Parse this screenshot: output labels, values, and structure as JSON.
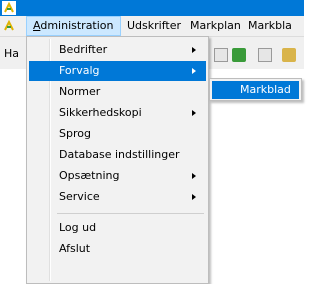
{
  "menubar": {
    "items": [
      {
        "accel": "A",
        "rest": "dministration"
      },
      {
        "label": "Udskrifter"
      },
      {
        "label": "Markplan"
      },
      {
        "label": "Markbla"
      }
    ]
  },
  "toolbar": {
    "label": "Ha"
  },
  "administration_menu": {
    "items": [
      {
        "label": "Bedrifter",
        "submenu": true
      },
      {
        "label": "Forvalg",
        "submenu": true,
        "selected": true
      },
      {
        "label": "Normer",
        "submenu": false
      },
      {
        "label": "Sikkerhedskopi",
        "submenu": true
      },
      {
        "label": "Sprog",
        "submenu": false
      },
      {
        "label": "Database indstillinger",
        "submenu": false
      },
      {
        "label": "Opsætning",
        "submenu": true
      },
      {
        "label": "Service",
        "submenu": true
      },
      {
        "label": "Log ud",
        "submenu": false
      },
      {
        "label": "Afslut",
        "submenu": false
      }
    ]
  },
  "forvalg_submenu": {
    "items": [
      {
        "label": "Markblad",
        "selected": true
      }
    ]
  },
  "colors": {
    "highlight": "#0078d7",
    "titlebar": "#0078d7",
    "menu_bg": "#f2f2f2"
  },
  "icons": [
    "app-logo-icon",
    "leaf-icon",
    "submenu-arrow-icon"
  ]
}
